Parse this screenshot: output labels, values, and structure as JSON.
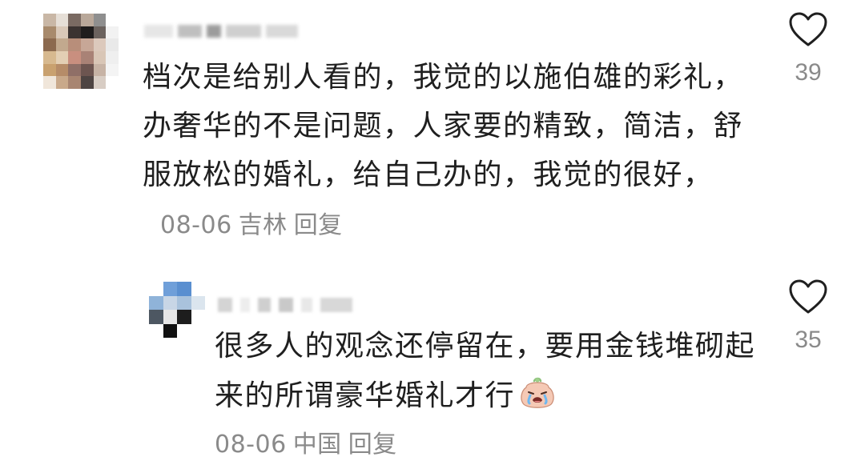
{
  "main_comment": {
    "text": "档次是给别人看的，我觉的以施伯雄的彩礼，办奢华的不是问题，人家要的精致，简洁，舒服放松的婚礼，给自己办的，我觉的很好，",
    "date": "08-06",
    "location": "吉林",
    "reply_label": "回复",
    "like_count": "39",
    "icons": {
      "like": "heart-outline-icon",
      "avatar": "pixelated-avatar"
    }
  },
  "reply_comment": {
    "text": "很多人的观念还停留在，要用金钱堆砌起来的所谓豪华婚礼才行",
    "emoji": "crying-face-emoji-icon",
    "date": "08-06",
    "location": "中国",
    "reply_label": "回复",
    "like_count": "35",
    "icons": {
      "like": "heart-outline-icon",
      "avatar": "pixelated-avatar"
    }
  },
  "colors": {
    "text": "#1f1f1f",
    "meta": "#8a8a8a",
    "heart_stroke": "#1f1f1f",
    "background": "#ffffff"
  }
}
